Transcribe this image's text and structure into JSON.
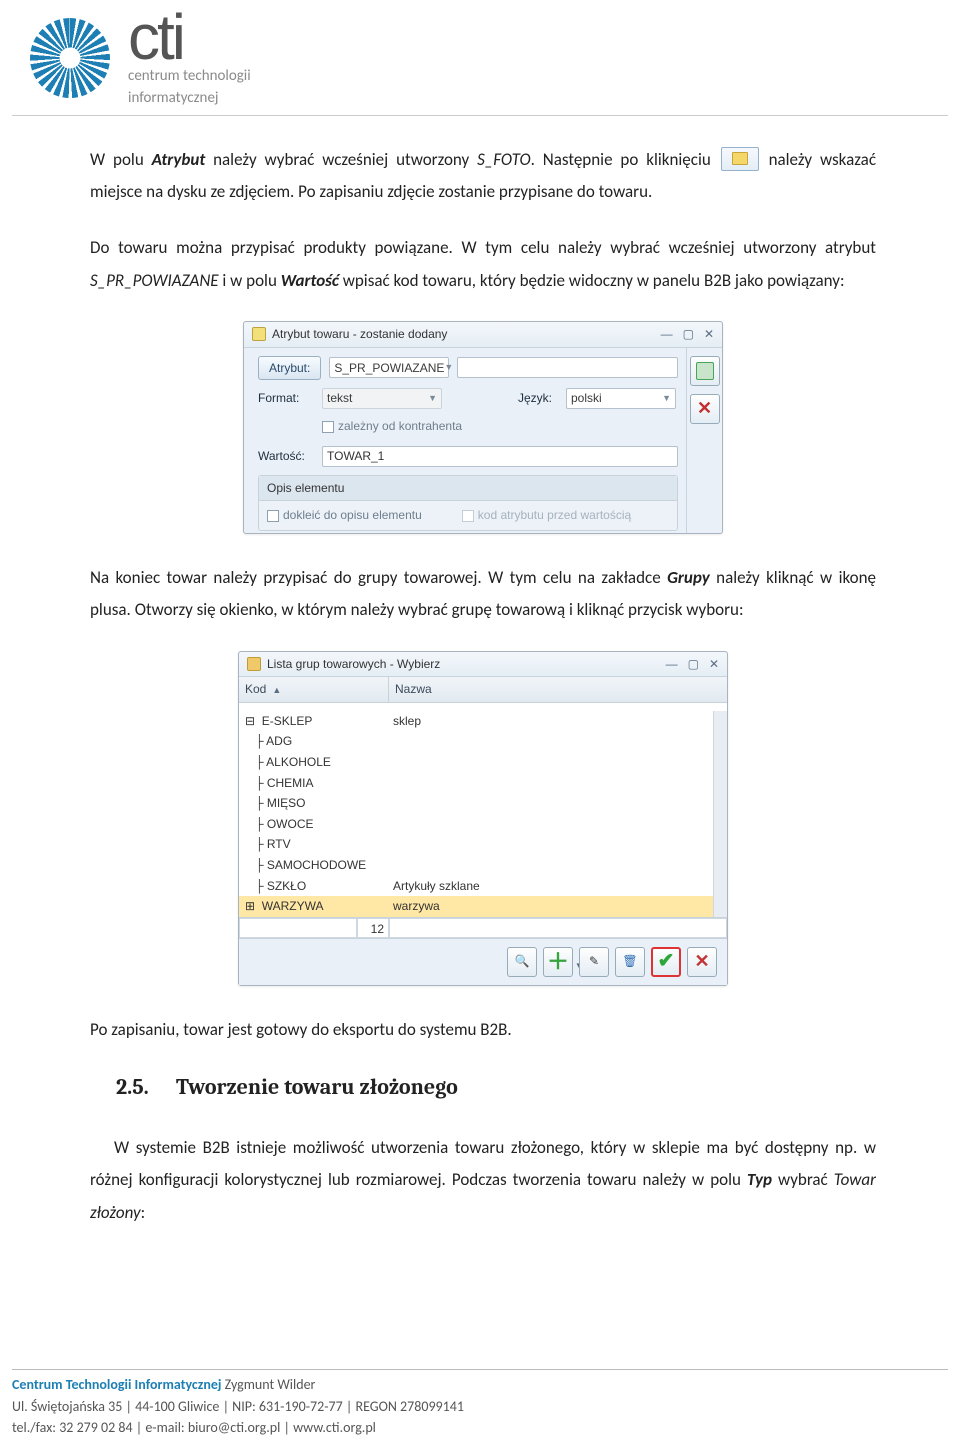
{
  "logo": {
    "cti": "cti",
    "sub1": "centrum technologii",
    "sub2": "informatycznej"
  },
  "p1": {
    "a": "W polu ",
    "b": "Atrybut",
    "c": " należy wybrać wcześniej utworzony ",
    "d": "S_FOTO",
    "e": ". Następnie po kliknięciu ",
    "f": " należy wskazać miejsce na dysku ze zdjęciem. Po zapisaniu zdjęcie zostanie przypisane do towaru."
  },
  "p2": {
    "a": "Do towaru można przypisać produkty powiązane. W tym celu należy wybrać wcześniej utworzony atrybut ",
    "b": "S_PR_POWIAZANE",
    "c": " i w polu ",
    "d": "Wartość",
    "e": " wpisać kod towaru, który będzie widoczny w panelu B2B jako powiązany:"
  },
  "shot1": {
    "title": "Atrybut towaru - zostanie dodany",
    "atrybut_lbl": "Atrybut:",
    "atrybut_val": "S_PR_POWIAZANE",
    "format_lbl": "Format:",
    "format_val": "tekst",
    "jezyk_lbl": "Język:",
    "jezyk_val": "polski",
    "chk_kontrah": "zależny od kontrahenta",
    "wartosc_lbl": "Wartość:",
    "wartosc_val": "TOWAR_1",
    "opis_h": "Opis elementu",
    "chk_dokleic": "dokleić do opisu elementu",
    "chk_kodattr": "kod atrybutu przed wartością"
  },
  "p3": {
    "a": "Na koniec towar należy przypisać do grupy towarowej. W tym celu na zakładce ",
    "b": "Grupy",
    "c": " należy kliknąć w ikonę plusa. Otworzy się okienko, w którym należy wybrać grupę towarową i kliknąć przycisk wyboru:"
  },
  "shot2": {
    "title": "Lista grup towarowych - Wybierz",
    "col_kod": "Kod",
    "col_nazwa": "Nazwa",
    "rows": [
      {
        "kod": "⊟  E-SKLEP",
        "nazwa": "sklep"
      },
      {
        "kod": "   ├ ADG",
        "nazwa": ""
      },
      {
        "kod": "   ├ ALKOHOLE",
        "nazwa": ""
      },
      {
        "kod": "   ├ CHEMIA",
        "nazwa": ""
      },
      {
        "kod": "   ├ MIĘSO",
        "nazwa": ""
      },
      {
        "kod": "   ├ OWOCE",
        "nazwa": ""
      },
      {
        "kod": "   ├ RTV",
        "nazwa": ""
      },
      {
        "kod": "   ├ SAMOCHODOWE",
        "nazwa": ""
      },
      {
        "kod": "   ├ SZKŁO",
        "nazwa": "Artykuły szklane"
      },
      {
        "kod": "⊞  WARZYWA",
        "nazwa": "warzywa",
        "sel": true
      }
    ],
    "count": "12"
  },
  "p4": "Po zapisaniu, towar jest gotowy do eksportu do systemu B2B.",
  "sec": {
    "num": "2.5.",
    "title": "Tworzenie towaru złożonego"
  },
  "p5": {
    "a": "W systemie B2B istnieje możliwość utworzenia towaru złożonego, który w sklepie ma być dostępny np. w różnej konfiguracji kolorystycznej lub rozmiarowej. Podczas tworzenia towaru należy w polu ",
    "b": "Typ",
    "c": " wybrać ",
    "d": "Towar złożony",
    "e": ":"
  },
  "footer": {
    "brand": "Centrum Technologii Informatycznej ",
    "owner": "Zygmunt Wilder",
    "line2": "Ul. Świętojańska 35  |  44-100 Gliwice  |  NIP: 631-190-72-77  |  REGON 278099141",
    "line3": "tel./fax: 32 279 02 84  |  e-mail: biuro@cti.org.pl  |  www.cti.org.pl"
  }
}
